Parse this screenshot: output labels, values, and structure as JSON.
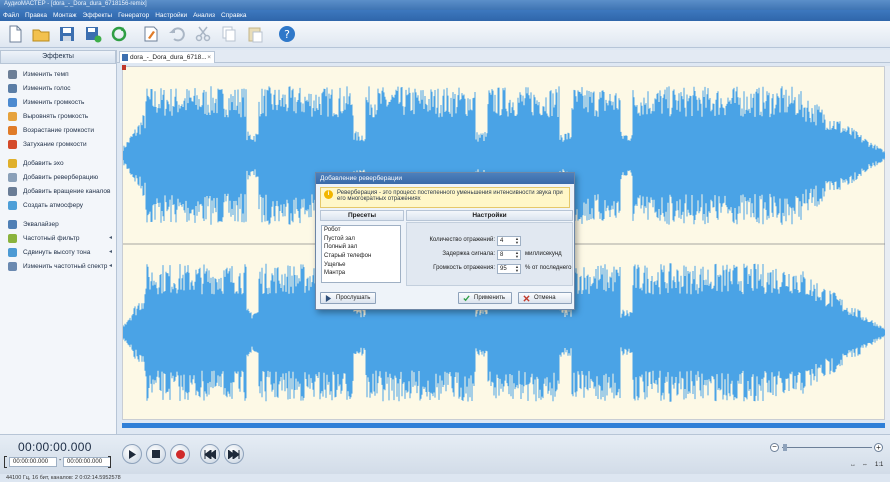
{
  "window": {
    "title": "АудиоМАСТЕР - [dora_-_Dora_dura_6718156-remix]"
  },
  "menu": [
    "Файл",
    "Правка",
    "Монтаж",
    "Эффекты",
    "Генератор",
    "Настройки",
    "Анализ",
    "Справка"
  ],
  "toolbar": {
    "buttons": [
      "new-file-icon",
      "open-folder-icon",
      "save-icon",
      "save-as-icon",
      "refresh-icon",
      "edit-icon",
      "undo-icon",
      "cut-icon",
      "copy-icon",
      "paste-icon",
      "help-icon"
    ]
  },
  "effects_panel": {
    "title": "Эффекты",
    "groups": [
      [
        {
          "label": "Изменить темп",
          "color": "#6d7f97"
        },
        {
          "label": "Изменить голос",
          "color": "#5b7ea6"
        },
        {
          "label": "Изменить громкость",
          "color": "#4c8ad0"
        },
        {
          "label": "Выровнять громкость",
          "color": "#e6a23c"
        },
        {
          "label": "Возрастание громкости",
          "color": "#e07b28"
        },
        {
          "label": "Затухание громкости",
          "color": "#d44a2a"
        }
      ],
      [
        {
          "label": "Добавить эхо",
          "color": "#e0b02b"
        },
        {
          "label": "Добавить реверберацию",
          "color": "#8aa0b8"
        },
        {
          "label": "Добавить вращение каналов",
          "color": "#6a7d96"
        },
        {
          "label": "Создать атмосферу",
          "color": "#4d9fd8"
        }
      ],
      [
        {
          "label": "Эквалайзер",
          "color": "#4f7fb5",
          "arrow": false
        },
        {
          "label": "Частотный фильтр",
          "color": "#8ab33d",
          "arrow": true
        },
        {
          "label": "Сдвинуть высоту тона",
          "color": "#4c9ad4",
          "arrow": true
        },
        {
          "label": "Изменить частотный спектр",
          "color": "#6a89b0",
          "arrow": true
        }
      ]
    ]
  },
  "tab": {
    "label": "dora_-_Dora_dura_6718..."
  },
  "colors": {
    "waveform": "#4aa3e6",
    "wave_bg": "#fdf9e6",
    "accent": "#2f7fd7"
  },
  "dialog": {
    "title": "Добавление реверберации",
    "info": "Реверберация - это процесс постепенного уменьшения интенсивности звука при его многократных отражениях",
    "presets_header": "Пресеты",
    "settings_header": "Настройки",
    "presets": [
      "Робот",
      "Пустой зал",
      "Полный зал",
      "Старый телефон",
      "Ущелье",
      "Мантра"
    ],
    "settings": [
      {
        "label": "Количество отражений:",
        "value": "4",
        "unit": ""
      },
      {
        "label": "Задержка сигнала:",
        "value": "8",
        "unit": "миллисекунд"
      },
      {
        "label": "Громкость отражения:",
        "value": "95",
        "unit": "% от последнего"
      }
    ],
    "listen": "Прослушать",
    "apply": "Применить",
    "cancel": "Отмена"
  },
  "transport": {
    "time": "00:00:00.000",
    "start": "00:00:00.000",
    "end": "00:00:00.000",
    "dash": "-",
    "zoom_ratio": "1:1"
  },
  "status": {
    "text": "44100 Гц, 16 бит, каналов: 2     0:02:14.5952578"
  }
}
